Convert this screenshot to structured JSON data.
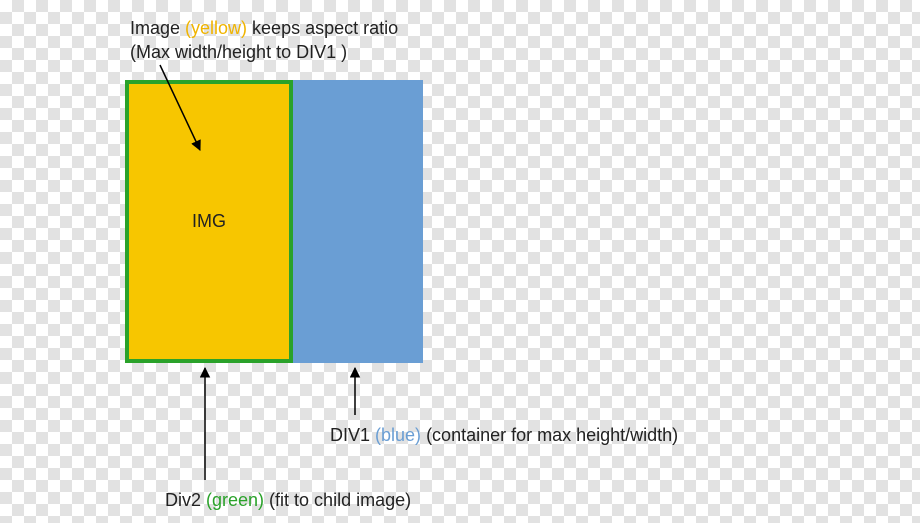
{
  "colors": {
    "yellow_text": "#f0b400",
    "blue_text": "#6a9ed4",
    "green_text": "#2aa22a",
    "div1_fill": "#6a9ed4",
    "div2_border": "#2aa22a",
    "img_fill": "#f7c600"
  },
  "captions": {
    "top": {
      "prefix": "Image ",
      "colored": "(yellow)",
      "suffix": " keeps aspect ratio",
      "line2": "(Max width/height to DIV1 )"
    },
    "img_label": "IMG",
    "div1": {
      "prefix": "DIV1 ",
      "colored": "(blue)",
      "suffix": " (container for max height/width)"
    },
    "div2": {
      "prefix": "Div2 ",
      "colored": "(green)",
      "suffix": " (fit to child image)"
    }
  }
}
